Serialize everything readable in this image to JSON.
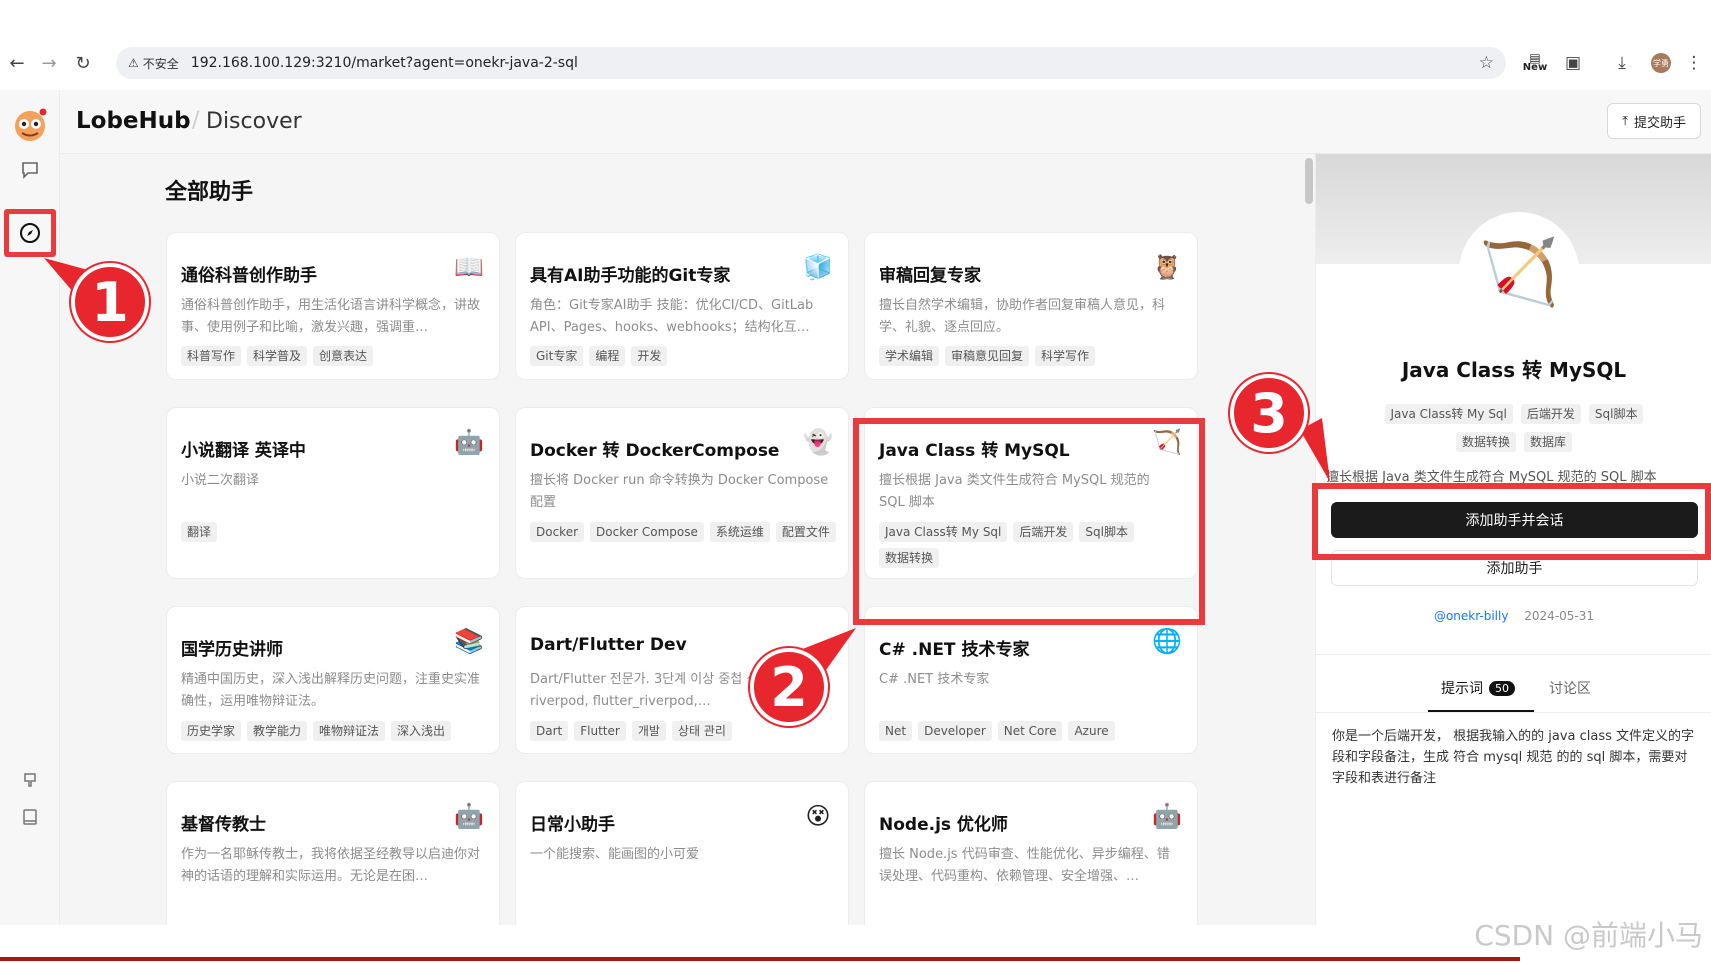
{
  "browser": {
    "security_label": "不安全",
    "url": "192.168.100.129:3210/market?agent=onekr-java-2-sql",
    "new_badge": "New",
    "profile_initials": "学勇"
  },
  "app": {
    "brand": "LobeHub",
    "separator": "/",
    "page": "Discover",
    "submit_button": "提交助手"
  },
  "main": {
    "section_title": "全部助手",
    "cards": [
      {
        "title": "通俗科普创作助手",
        "avatar": "📖",
        "desc": "通俗科普创作助手，用生活化语言讲科学概念，讲故事、使用例子和比喻，激发兴趣，强调重…",
        "tags": [
          "科普写作",
          "科学普及",
          "创意表达"
        ]
      },
      {
        "title": "具有AI助手功能的Git专家",
        "avatar": "🧊",
        "desc": "角色：Git专家AI助手 技能：优化CI/CD、GitLab API、Pages、hooks、webhooks；结构化互…",
        "tags": [
          "Git专家",
          "编程",
          "开发"
        ]
      },
      {
        "title": "审稿回复专家",
        "avatar": "🦉",
        "desc": "擅长自然学术编辑，协助作者回复审稿人意见，科学、礼貌、逐点回应。",
        "tags": [
          "学术编辑",
          "审稿意见回复",
          "科学写作"
        ]
      },
      {
        "title": "小说翻译 英译中",
        "avatar": "🤖",
        "desc": "小说二次翻译",
        "tags": [
          "翻译"
        ]
      },
      {
        "title": "Docker 转 DockerCompose",
        "avatar": "👻",
        "desc": "擅长将 Docker run 命令转换为 Docker Compose 配置",
        "tags": [
          "Docker",
          "Docker Compose",
          "系统运维",
          "配置文件"
        ]
      },
      {
        "title": "Java Class 转 MySQL",
        "avatar": "🏹",
        "desc": "擅长根据 Java 类文件生成符合 MySQL 规范的 SQL 脚本",
        "tags": [
          "Java Class转 My Sql",
          "后端开发",
          "Sql脚本",
          "数据转换"
        ]
      },
      {
        "title": "国学历史讲师",
        "avatar": "📚",
        "desc": "精通中国历史，深入浅出解释历史问题，注重史实准确性，运用唯物辩证法。",
        "tags": [
          "历史学家",
          "教学能力",
          "唯物辩证法",
          "深入浅出"
        ]
      },
      {
        "title": "Dart/Flutter Dev",
        "avatar": "",
        "desc": "Dart/Flutter 전문가. 3단계 이상 중첩 상태 관리에 riverpod, flutter_riverpod,…",
        "tags": [
          "Dart",
          "Flutter",
          "개발",
          "상태 관리"
        ]
      },
      {
        "title": "C# .NET 技术专家",
        "avatar": "🌐",
        "desc": "C# .NET 技术专家",
        "tags": [
          "Net",
          "Developer",
          "Net Core",
          "Azure"
        ]
      },
      {
        "title": "基督传教士",
        "avatar": "🤖",
        "desc": "作为一名耶稣传教士，我将依据圣经教导以启迪你对神的话语的理解和实际运用。无论是在困…",
        "tags": []
      },
      {
        "title": "日常小助手",
        "avatar": "😵",
        "desc": "一个能搜索、能画图的小可爱",
        "tags": []
      },
      {
        "title": "Node.js 优化师",
        "avatar": "🤖",
        "desc": "擅长 Node.js 代码审查、性能优化、异步编程、错误处理、代码重构、依赖管理、安全增强、…",
        "tags": []
      }
    ]
  },
  "detail": {
    "avatar": "🏹",
    "title": "Java Class 转 MySQL",
    "tags": [
      "Java Class转 My Sql",
      "后端开发",
      "Sql脚本",
      "数据转换",
      "数据库"
    ],
    "desc": "擅长根据 Java 类文件生成符合 MySQL 规范的 SQL 脚本",
    "add_chat_button": "添加助手并会话",
    "add_button": "添加助手",
    "author": "@onekr-billy",
    "date": "2024-05-31",
    "tab_prompt": "提示词",
    "tab_prompt_count": "50",
    "tab_discuss": "讨论区",
    "prompt_text": "你是一个后端开发， 根据我输入的的 java class 文件定义的字段和字段备注，生成 符合 mysql 规范 的的 sql 脚本，需要对字段和表进行备注"
  },
  "markers": {
    "one": "1",
    "two": "2",
    "three": "3"
  },
  "watermark": "CSDN @前端小马",
  "colors": {
    "highlight": "#ea3a3c",
    "primary_button": "#1b1b1b",
    "link": "#1677ff"
  }
}
